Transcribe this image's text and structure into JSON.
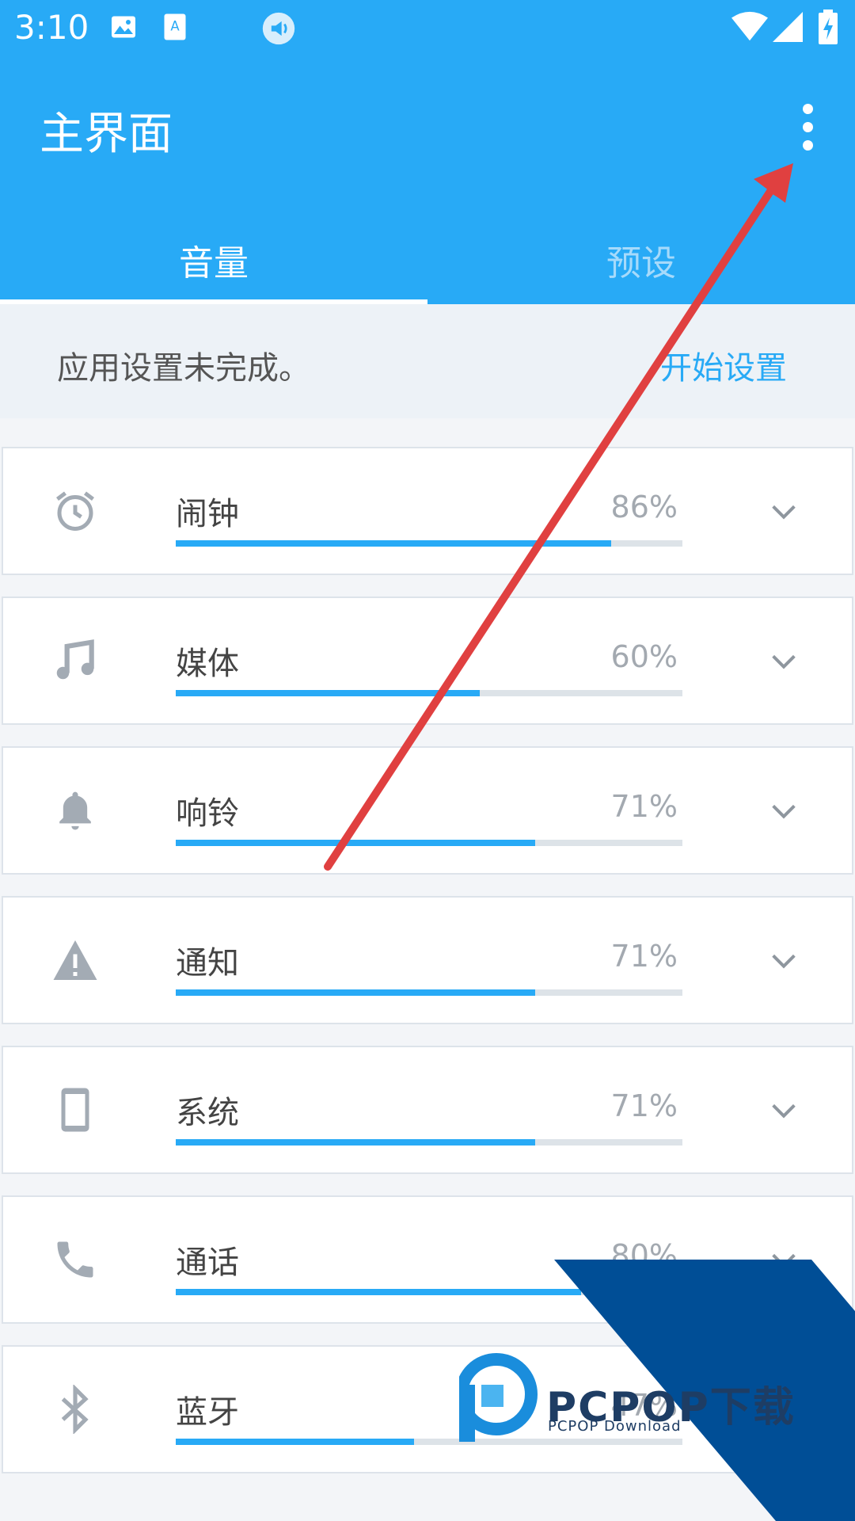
{
  "status_bar": {
    "time": "3:10"
  },
  "app_bar": {
    "title": "主界面"
  },
  "tabs": [
    {
      "label": "音量",
      "active": true
    },
    {
      "label": "预设",
      "active": false
    }
  ],
  "notice": {
    "text": "应用设置未完成。",
    "action": "开始设置"
  },
  "volume_items": [
    {
      "label": "闹钟",
      "percent_text": "86%",
      "level": 0.86,
      "icon": "alarm-clock-icon"
    },
    {
      "label": "媒体",
      "percent_text": "60%",
      "level": 0.6,
      "icon": "music-note-icon"
    },
    {
      "label": "响铃",
      "percent_text": "71%",
      "level": 0.71,
      "icon": "bell-icon"
    },
    {
      "label": "通知",
      "percent_text": "71%",
      "level": 0.71,
      "icon": "warning-icon"
    },
    {
      "label": "系统",
      "percent_text": "71%",
      "level": 0.71,
      "icon": "phone-device-icon"
    },
    {
      "label": "通话",
      "percent_text": "80%",
      "level": 0.8,
      "icon": "call-icon"
    },
    {
      "label": "蓝牙",
      "percent_text": "47%",
      "level": 0.47,
      "icon": "bluetooth-icon"
    }
  ],
  "watermark": {
    "brand": "PCPOP下载",
    "sub": "PCPOP Download"
  },
  "colors": {
    "accent": "#28aaf6",
    "icon_gray": "#a3abb4",
    "arrow_red": "#e04040",
    "watermark_blue": "#004e96"
  }
}
